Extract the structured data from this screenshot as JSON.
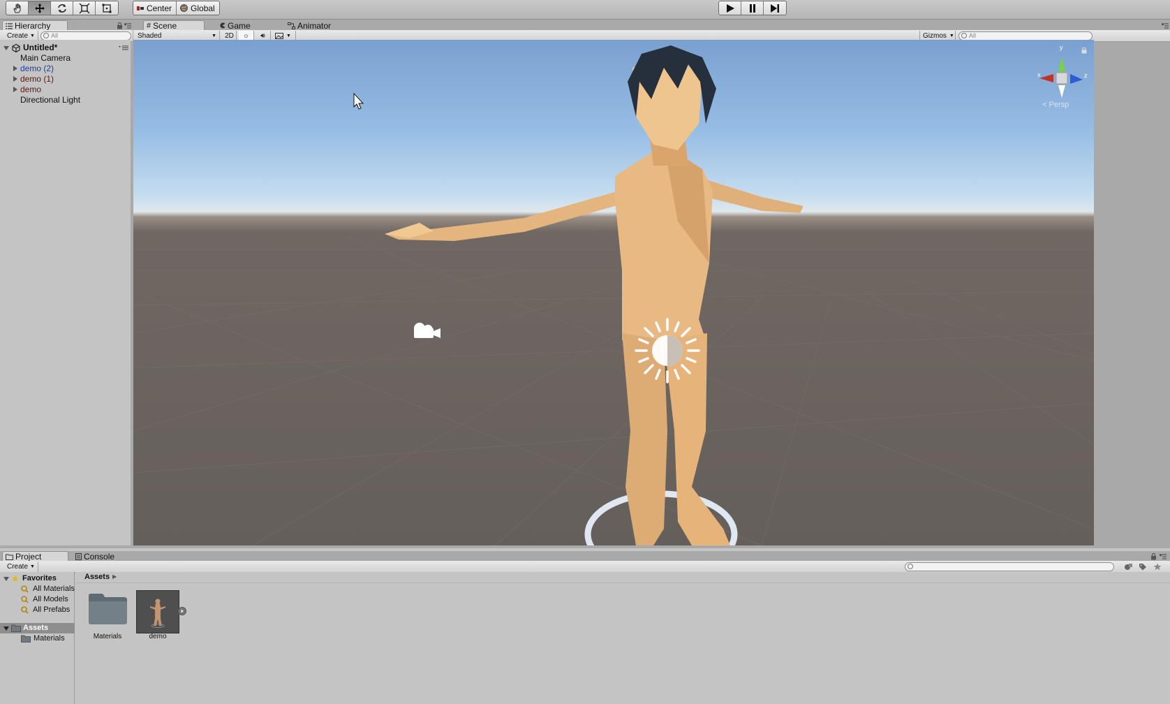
{
  "toolbar": {
    "tools": [
      "hand-icon",
      "move-icon",
      "rotate-icon",
      "scale-icon",
      "rect-icon"
    ],
    "pivot_center": "Center",
    "pivot_global": "Global",
    "play_controls": [
      "play-icon",
      "pause-icon",
      "step-icon"
    ]
  },
  "hierarchy": {
    "tab_label": "Hierarchy",
    "create_label": "Create",
    "search_placeholder": "All",
    "scene_name": "Untitled*",
    "items": [
      {
        "label": "Main Camera",
        "color": "#111111"
      },
      {
        "label": "demo (2)",
        "color": "#1c3ea0"
      },
      {
        "label": "demo (1)",
        "color": "#5a1a10"
      },
      {
        "label": "demo",
        "color": "#5a1a10"
      },
      {
        "label": "Directional Light",
        "color": "#111111"
      }
    ]
  },
  "scene_view": {
    "tabs": [
      {
        "label": "Scene",
        "icon": "grid-icon",
        "active": true
      },
      {
        "label": "Game",
        "icon": "pacman-icon",
        "active": false
      },
      {
        "label": "Animator",
        "icon": "nodes-icon",
        "active": false
      }
    ],
    "shading_mode": "Shaded",
    "mode_2d": "2D",
    "gizmos_label": "Gizmos",
    "search_placeholder": "All",
    "persp_label": "Persp",
    "axis_x": "x",
    "axis_y": "y",
    "axis_z": "z"
  },
  "project": {
    "tabs": [
      {
        "label": "Project",
        "active": true
      },
      {
        "label": "Console",
        "active": false
      }
    ],
    "create_label": "Create",
    "favorites_label": "Favorites",
    "favorites": [
      "All Materials",
      "All Models",
      "All Prefabs"
    ],
    "assets_label": "Assets",
    "asset_folders": [
      "Materials"
    ],
    "breadcrumb": "Assets",
    "assets": [
      {
        "label": "Materials",
        "kind": "folder"
      },
      {
        "label": "demo",
        "kind": "model"
      }
    ]
  }
}
